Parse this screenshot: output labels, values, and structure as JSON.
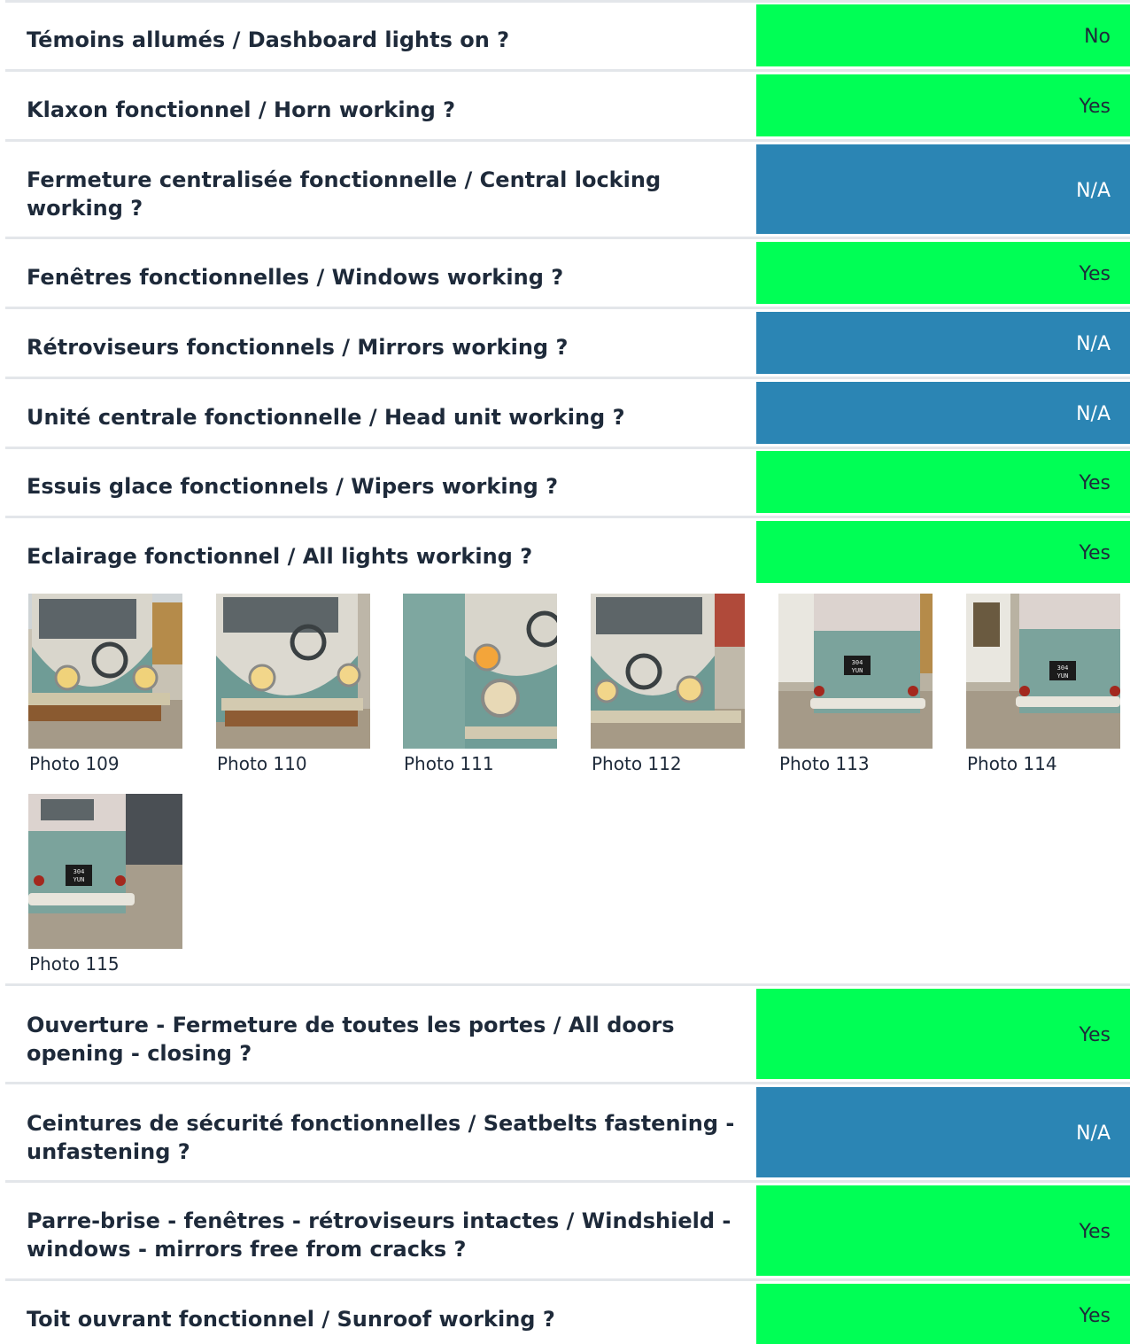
{
  "checks": [
    {
      "question": "Témoins allumés / Dashboard lights on ?",
      "answer": "No"
    },
    {
      "question": "Klaxon fonctionnel / Horn working ?",
      "answer": "Yes"
    },
    {
      "question": "Fermeture centralisée fonctionnelle / Central locking working ?",
      "answer": "N/A"
    },
    {
      "question": "Fenêtres fonctionnelles / Windows working ?",
      "answer": "Yes"
    },
    {
      "question": "Rétroviseurs fonctionnels / Mirrors working ?",
      "answer": "N/A"
    },
    {
      "question": "Unité centrale fonctionnelle / Head unit working ?",
      "answer": "N/A"
    },
    {
      "question": "Essuis glace fonctionnels / Wipers working ?",
      "answer": "Yes"
    },
    {
      "question": "Eclairage fonctionnel / All lights working ?",
      "answer": "Yes"
    },
    {
      "question": "Ouverture - Fermeture de toutes les portes / All doors opening - closing ?",
      "answer": "Yes"
    },
    {
      "question": "Ceintures de sécurité fonctionnelles / Seatbelts fastening - unfastening ?",
      "answer": "N/A"
    },
    {
      "question": "Parre-brise - fenêtres - rétroviseurs intactes / Windshield - windows - mirrors free from cracks ?",
      "answer": "Yes"
    },
    {
      "question": "Toit ouvrant fonctionnel / Sunroof working ?",
      "answer": "Yes"
    }
  ],
  "photos": [
    {
      "caption": "Photo 109",
      "view": "front"
    },
    {
      "caption": "Photo 110",
      "view": "front"
    },
    {
      "caption": "Photo 111",
      "view": "front-side"
    },
    {
      "caption": "Photo 112",
      "view": "front"
    },
    {
      "caption": "Photo 113",
      "view": "rear"
    },
    {
      "caption": "Photo 114",
      "view": "rear"
    },
    {
      "caption": "Photo 115",
      "view": "rear"
    }
  ],
  "plate_text": [
    "304",
    "YUN"
  ],
  "colors": {
    "yes": "#00ff55",
    "no": "#00ff55",
    "na": "#2b85b4",
    "text": "#1e2a3a",
    "rule": "#e3e6ea"
  }
}
